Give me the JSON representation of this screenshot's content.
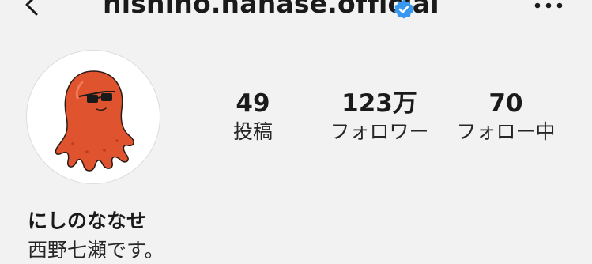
{
  "header": {
    "back_icon": "chevron-left-icon",
    "username": "nishino.nanase.official",
    "verified_icon": "verified-badge-icon",
    "more_icon": "more-horizontal-icon"
  },
  "profile": {
    "avatar_icon": "octopus-mascot-with-sunglasses",
    "stats": [
      {
        "value": "49",
        "label": "投稿"
      },
      {
        "value": "123万",
        "label": "フォロワー"
      },
      {
        "value": "70",
        "label": "フォロー中"
      }
    ],
    "display_name": "にしのななせ",
    "bio": "西野七瀬です。"
  },
  "colors": {
    "background": "#f2f2f2",
    "verified_blue": "#3897f0",
    "avatar_orange": "#e0532f"
  }
}
